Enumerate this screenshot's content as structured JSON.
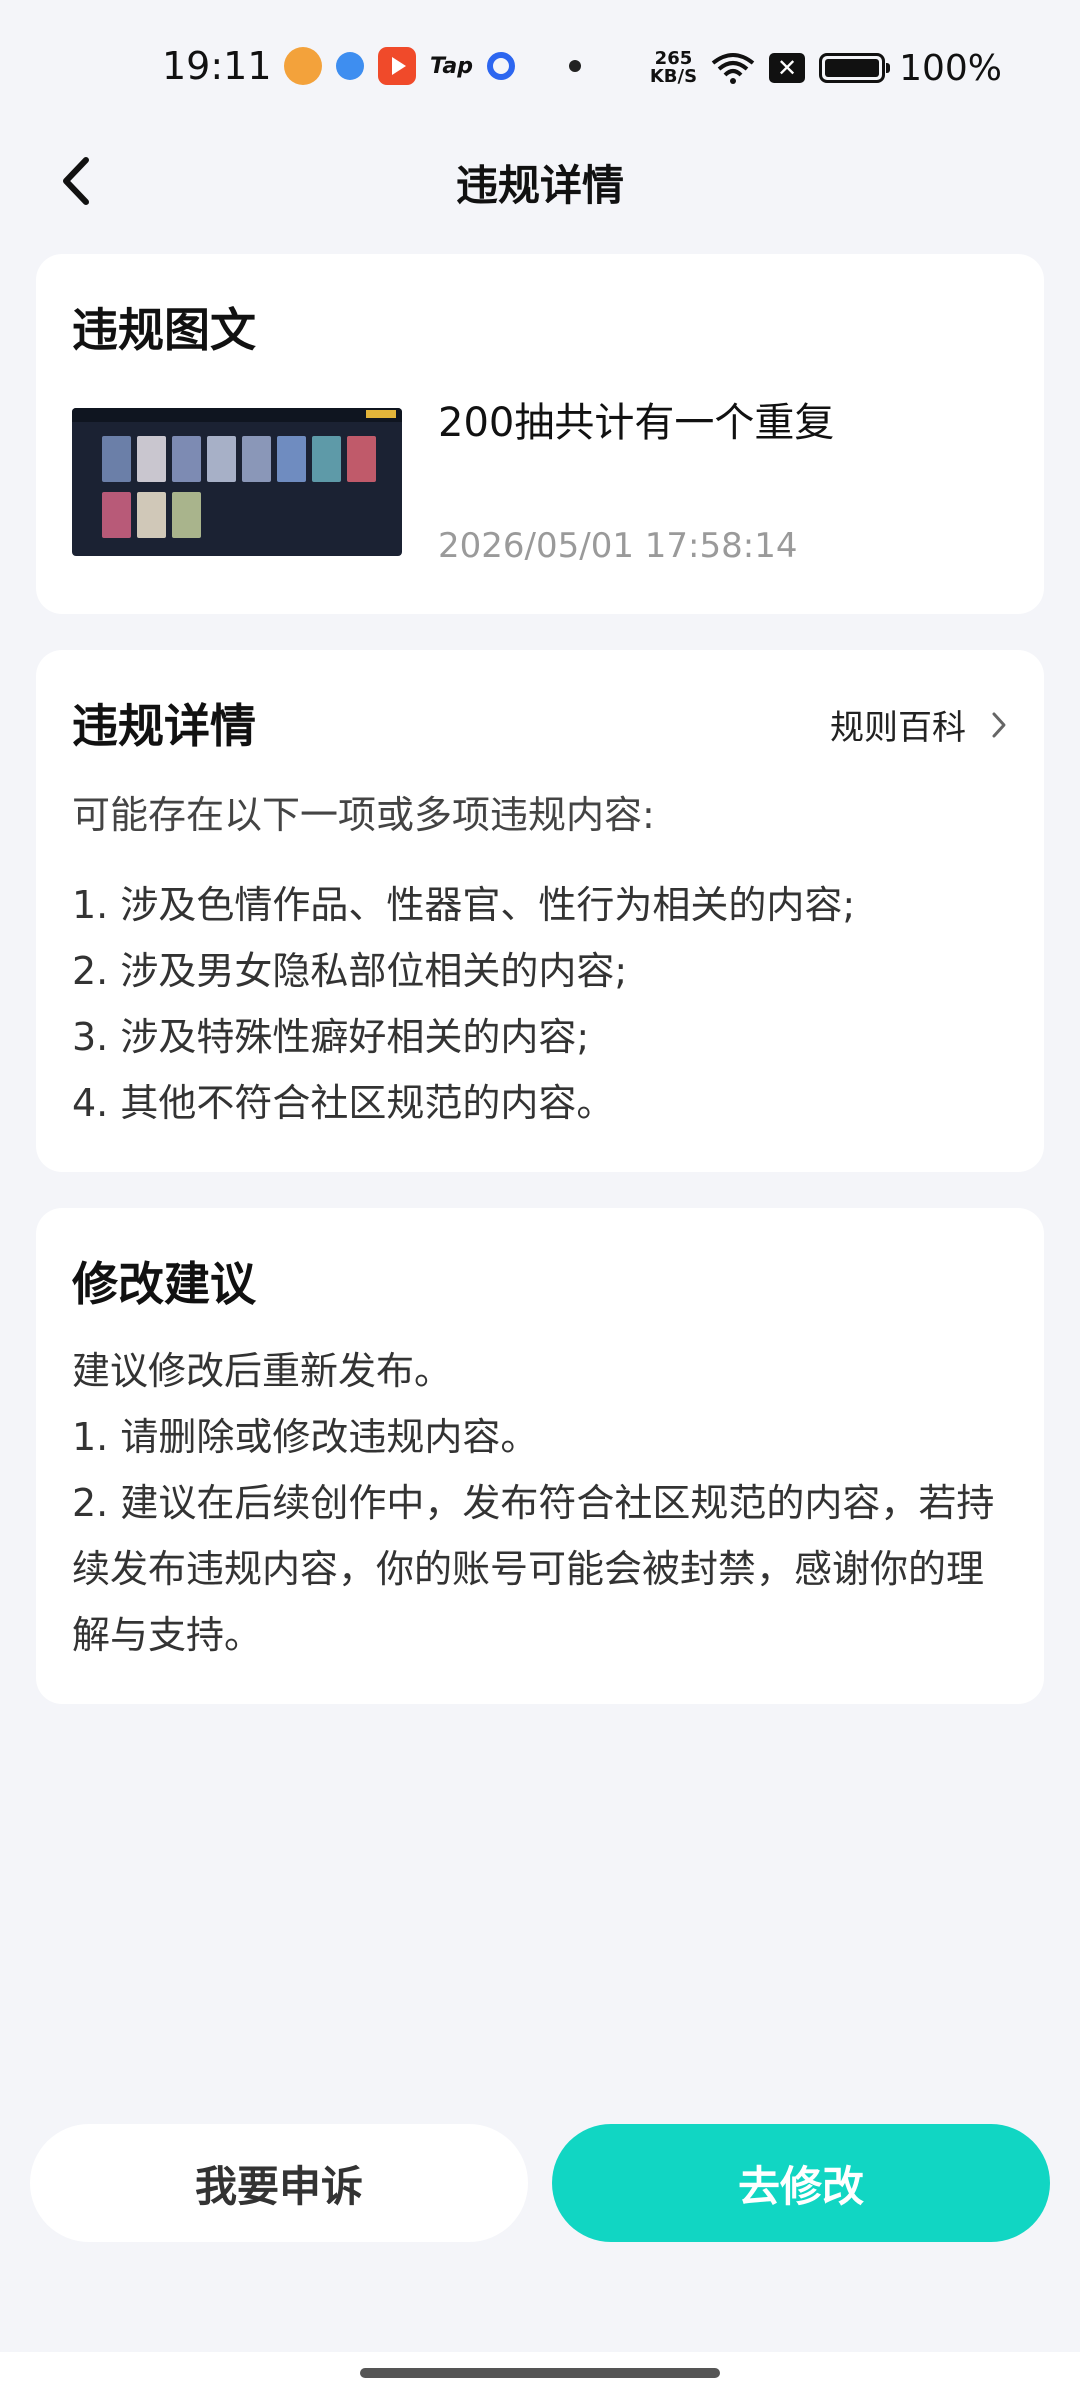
{
  "status_bar": {
    "time": "19:11",
    "tap_label": "Tap",
    "net_speed_top": "265",
    "net_speed_bottom": "KB/S",
    "battery": "100%",
    "icons": [
      "avatar-app-icon",
      "blue-app-icon",
      "video-app-icon",
      "tap-app-icon",
      "ring-app-icon",
      "wifi-icon",
      "no-sim-icon",
      "battery-icon"
    ]
  },
  "header": {
    "title": "违规详情",
    "back_icon": "chevron-left-icon"
  },
  "post_card": {
    "title": "违规图文",
    "post_title": "200抽共计有一个重复",
    "post_time": "2026/05/01 17:58:14"
  },
  "violation_card": {
    "title": "违规详情",
    "rules_link": "规则百科",
    "intro": "可能存在以下一项或多项违规内容:",
    "items": [
      "1. 涉及色情作品、性器官、性行为相关的内容;",
      "2. 涉及男女隐私部位相关的内容;",
      "3. 涉及特殊性癖好相关的内容;",
      "4. 其他不符合社区规范的内容。"
    ]
  },
  "suggestion_card": {
    "title": "修改建议",
    "lines": [
      "建议修改后重新发布。",
      "1. 请删除或修改违规内容。",
      "2. 建议在后续创作中，发布符合社区规范的内容，若持续发布违规内容，你的账号可能会被封禁，感谢你的理解与支持。"
    ]
  },
  "actions": {
    "appeal": "我要申诉",
    "modify": "去修改"
  },
  "colors": {
    "accent": "#11d6c3",
    "background": "#f4f5f9"
  }
}
